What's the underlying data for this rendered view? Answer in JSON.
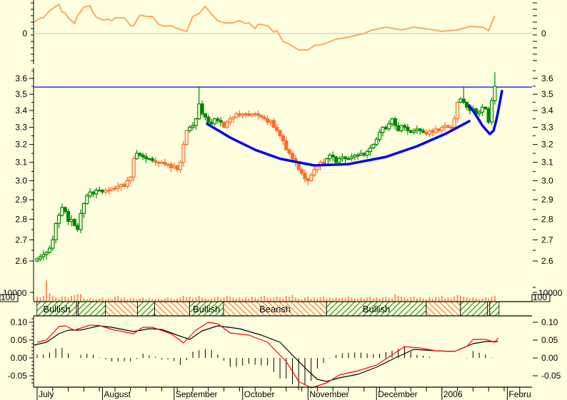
{
  "chart_data": {
    "type": "candlestick",
    "title": "",
    "x_axis": {
      "months": [
        {
          "label": "July",
          "day": 0
        },
        {
          "label": "August",
          "day": 21
        },
        {
          "label": "September",
          "day": 44
        },
        {
          "label": "October",
          "day": 66
        },
        {
          "label": "November",
          "day": 87
        },
        {
          "label": "December",
          "day": 109
        },
        {
          "label": "2006",
          "day": 130
        },
        {
          "label": "Febru",
          "day": 151
        }
      ]
    },
    "price_pane": {
      "scale": "log",
      "ylim": [
        2.56,
        3.7
      ],
      "ticks": [
        "2.6",
        "2.7",
        "2.8",
        "2.9",
        "3.0",
        "3.1",
        "3.2",
        "3.3",
        "3.4",
        "3.5",
        "3.6"
      ],
      "first_open": 2.6,
      "close": [
        2.61,
        2.62,
        2.63,
        2.64,
        2.66,
        2.7,
        2.78,
        2.82,
        2.86,
        2.84,
        2.79,
        2.8,
        2.77,
        2.75,
        2.83,
        2.88,
        2.92,
        2.94,
        2.93,
        2.95,
        2.95,
        2.94,
        2.95,
        2.95,
        2.96,
        2.96,
        2.97,
        2.98,
        2.97,
        3.0,
        3.02,
        3.12,
        3.15,
        3.14,
        3.13,
        3.12,
        3.12,
        3.11,
        3.1,
        3.1,
        3.1,
        3.09,
        3.09,
        3.07,
        3.08,
        3.06,
        3.1,
        3.2,
        3.28,
        3.3,
        3.31,
        3.35,
        3.44,
        3.38,
        3.36,
        3.33,
        3.32,
        3.35,
        3.34,
        3.33,
        3.3,
        3.33,
        3.35,
        3.36,
        3.38,
        3.37,
        3.38,
        3.38,
        3.37,
        3.38,
        3.38,
        3.37,
        3.36,
        3.35,
        3.33,
        3.34,
        3.3,
        3.28,
        3.25,
        3.22,
        3.17,
        3.15,
        3.12,
        3.1,
        3.06,
        3.04,
        3.01,
        3.0,
        3.03,
        3.06,
        3.08,
        3.1,
        3.09,
        3.12,
        3.14,
        3.13,
        3.1,
        3.12,
        3.13,
        3.12,
        3.12,
        3.13,
        3.14,
        3.14,
        3.15,
        3.14,
        3.16,
        3.18,
        3.2,
        3.23,
        3.27,
        3.3,
        3.29,
        3.32,
        3.35,
        3.31,
        3.28,
        3.31,
        3.3,
        3.28,
        3.27,
        3.28,
        3.29,
        3.28,
        3.27,
        3.26,
        3.28,
        3.27,
        3.29,
        3.28,
        3.3,
        3.31,
        3.3,
        3.3,
        3.35,
        3.45,
        3.47,
        3.45,
        3.42,
        3.4,
        3.41,
        3.38,
        3.39,
        3.42,
        3.41,
        3.33,
        3.46,
        3.55
      ],
      "notable_highs": {
        "52": 3.55,
        "137": 3.55,
        "147": 3.64
      },
      "resistance_level": 3.545,
      "annotations": {
        "cup": [
          [
            54.6,
            3.32
          ],
          [
            62,
            3.24
          ],
          [
            70,
            3.17
          ],
          [
            78,
            3.12
          ],
          [
            89,
            3.083
          ],
          [
            100,
            3.09
          ],
          [
            112,
            3.13
          ],
          [
            122,
            3.19
          ],
          [
            131,
            3.26
          ],
          [
            138.8,
            3.336
          ]
        ],
        "handle": [
          [
            138.8,
            3.43
          ],
          [
            141,
            3.37
          ],
          [
            143,
            3.31
          ],
          [
            145.4,
            3.26
          ],
          [
            146.6,
            3.28
          ],
          [
            147.6,
            3.35
          ],
          [
            148.5,
            3.44
          ],
          [
            149.3,
            3.52
          ]
        ]
      },
      "colors": {
        "bull": "#008800",
        "bear": "#FF6A2A",
        "resistance": "#0000FF",
        "curve": "#0000EE"
      }
    },
    "oscillator_pane": {
      "zero_label": "0",
      "color": "#FFA860",
      "points": [
        [
          -1,
          16
        ],
        [
          1,
          22
        ],
        [
          2,
          22
        ],
        [
          4,
          32
        ],
        [
          7,
          41
        ],
        [
          8,
          30
        ],
        [
          9,
          29
        ],
        [
          10,
          22
        ],
        [
          12,
          14
        ],
        [
          13,
          25
        ],
        [
          15,
          37
        ],
        [
          17,
          39
        ],
        [
          18,
          29
        ],
        [
          19,
          23
        ],
        [
          21,
          19
        ],
        [
          23,
          20
        ],
        [
          24,
          18
        ],
        [
          25,
          22
        ],
        [
          28,
          22
        ],
        [
          30,
          11
        ],
        [
          31,
          11
        ],
        [
          33,
          26
        ],
        [
          35,
          24
        ],
        [
          37,
          24
        ],
        [
          39,
          13
        ],
        [
          41,
          10
        ],
        [
          43,
          11
        ],
        [
          45,
          7
        ],
        [
          48,
          3
        ],
        [
          50,
          24
        ],
        [
          52,
          28
        ],
        [
          54,
          38
        ],
        [
          56,
          27
        ],
        [
          58,
          18
        ],
        [
          60,
          15
        ],
        [
          63,
          15
        ],
        [
          65,
          18
        ],
        [
          67,
          14
        ],
        [
          68,
          15
        ],
        [
          70,
          7
        ],
        [
          71,
          13
        ],
        [
          74,
          11
        ],
        [
          76,
          2
        ],
        [
          77,
          4
        ],
        [
          79,
          -11
        ],
        [
          81,
          -15
        ],
        [
          84,
          -23
        ],
        [
          87,
          -23
        ],
        [
          89,
          -17
        ],
        [
          92,
          -15
        ],
        [
          96,
          -8
        ],
        [
          100,
          -5
        ],
        [
          105,
          0
        ],
        [
          107,
          4
        ],
        [
          112,
          9
        ],
        [
          117,
          5
        ],
        [
          121,
          9
        ],
        [
          126,
          6
        ],
        [
          130,
          3
        ],
        [
          135,
          5
        ],
        [
          139,
          10
        ],
        [
          143,
          9
        ],
        [
          145,
          4
        ],
        [
          147,
          25
        ]
      ]
    },
    "volume_pane": {
      "label": "10000",
      "box_label": "100",
      "unit_thousands": true,
      "color": "#F89060",
      "values": [
        5,
        4,
        6,
        24,
        9,
        6,
        4,
        3,
        5,
        5,
        4,
        6,
        7,
        8,
        8,
        3,
        2,
        3,
        2,
        2,
        3,
        4,
        2,
        3,
        2,
        5,
        6,
        3,
        4,
        2,
        3,
        3,
        2,
        3,
        4,
        2,
        3,
        2,
        2,
        3,
        2,
        3,
        4,
        3,
        2,
        3,
        4,
        6,
        4,
        5,
        3,
        4,
        6,
        4,
        3,
        2,
        3,
        4,
        5,
        3,
        4,
        6,
        5,
        4,
        3,
        4,
        3,
        4,
        3,
        5,
        4,
        3,
        5,
        6,
        4,
        3,
        4,
        5,
        4,
        3,
        6,
        5,
        7,
        4,
        3,
        2,
        4,
        5,
        3,
        4,
        3,
        4,
        5,
        3,
        4,
        3,
        4,
        3,
        4,
        3,
        5,
        4,
        3,
        3,
        4,
        3,
        4,
        5,
        3,
        4,
        3,
        4,
        5,
        4,
        3,
        8,
        6,
        5,
        4,
        3,
        4,
        5,
        3,
        4,
        3,
        2,
        4,
        3,
        5,
        4,
        6,
        3,
        4,
        3,
        5,
        7,
        6,
        5,
        4,
        3,
        4,
        3,
        2,
        3,
        4,
        3,
        5,
        6
      ]
    },
    "signal_band": {
      "segments": [
        {
          "from": 0,
          "to": 12.7,
          "type": "bull",
          "label": "Bullish"
        },
        {
          "from": 12.7,
          "to": 13.2,
          "type": "bear",
          "label": ""
        },
        {
          "from": 13.2,
          "to": 22,
          "type": "bull",
          "label": ""
        },
        {
          "from": 22,
          "to": 32.3,
          "type": "bear",
          "label": ""
        },
        {
          "from": 32.3,
          "to": 37.8,
          "type": "bull",
          "label": ""
        },
        {
          "from": 37.8,
          "to": 49,
          "type": "bear",
          "label": ""
        },
        {
          "from": 49,
          "to": 59.9,
          "type": "bull",
          "label": "Bullish"
        },
        {
          "from": 59.9,
          "to": 93,
          "type": "bear",
          "label": "Bearish"
        },
        {
          "from": 93,
          "to": 125,
          "type": "bull",
          "label": "Bullish"
        },
        {
          "from": 125,
          "to": 136,
          "type": "bear",
          "label": ""
        },
        {
          "from": 136,
          "to": 144.7,
          "type": "bull",
          "label": ""
        },
        {
          "from": 144.7,
          "to": 145.4,
          "type": "bear",
          "label": ""
        },
        {
          "from": 145.4,
          "to": 148.4,
          "type": "bull",
          "label": ""
        }
      ]
    },
    "macd_pane": {
      "ticks": [
        {
          "v": 0.1,
          "label": "0.10"
        },
        {
          "v": 0.05,
          "label": "0.05"
        },
        {
          "v": 0,
          "label": "0.00"
        },
        {
          "v": -0.05,
          "label": "-0.05"
        }
      ],
      "ylim": [
        -0.075,
        0.12
      ],
      "macd_color": "#FF0000",
      "signal_color": "#000000",
      "macd": [
        [
          0,
          0.044
        ],
        [
          3,
          0.05
        ],
        [
          7,
          0.088
        ],
        [
          9,
          0.09
        ],
        [
          12,
          0.078
        ],
        [
          17,
          0.092
        ],
        [
          20,
          0.091
        ],
        [
          24,
          0.08
        ],
        [
          31,
          0.068
        ],
        [
          34,
          0.086
        ],
        [
          37,
          0.086
        ],
        [
          43,
          0.068
        ],
        [
          47,
          0.042
        ],
        [
          51,
          0.078
        ],
        [
          55,
          0.1
        ],
        [
          58,
          0.096
        ],
        [
          62,
          0.07
        ],
        [
          68,
          0.064
        ],
        [
          74,
          0.044
        ],
        [
          80,
          -0.01
        ],
        [
          84,
          -0.066
        ],
        [
          88,
          -0.084
        ],
        [
          93,
          -0.07
        ],
        [
          97,
          -0.048
        ],
        [
          103,
          -0.036
        ],
        [
          109,
          -0.02
        ],
        [
          115,
          0.014
        ],
        [
          118,
          0.032
        ],
        [
          123,
          0.028
        ],
        [
          128,
          0.02
        ],
        [
          134,
          0.018
        ],
        [
          138,
          0.032
        ],
        [
          140,
          0.052
        ],
        [
          144,
          0.052
        ],
        [
          147,
          0.044
        ],
        [
          148,
          0.056
        ]
      ],
      "signal": [
        [
          -1,
          0.036
        ],
        [
          3,
          0.044
        ],
        [
          7,
          0.068
        ],
        [
          10,
          0.078
        ],
        [
          14,
          0.078
        ],
        [
          20,
          0.09
        ],
        [
          24,
          0.086
        ],
        [
          31,
          0.074
        ],
        [
          36,
          0.082
        ],
        [
          40,
          0.08
        ],
        [
          45,
          0.064
        ],
        [
          49,
          0.052
        ],
        [
          53,
          0.076
        ],
        [
          58,
          0.09
        ],
        [
          65,
          0.082
        ],
        [
          72,
          0.064
        ],
        [
          78,
          0.044
        ],
        [
          82,
          0.008
        ],
        [
          87,
          -0.036
        ],
        [
          90,
          -0.06
        ],
        [
          93,
          -0.066
        ],
        [
          97,
          -0.056
        ],
        [
          103,
          -0.046
        ],
        [
          109,
          -0.026
        ],
        [
          115,
          0
        ],
        [
          121,
          0.024
        ],
        [
          128,
          0.02
        ],
        [
          134,
          0.018
        ],
        [
          140,
          0.04
        ],
        [
          144,
          0.046
        ],
        [
          148,
          0.046
        ]
      ]
    }
  }
}
